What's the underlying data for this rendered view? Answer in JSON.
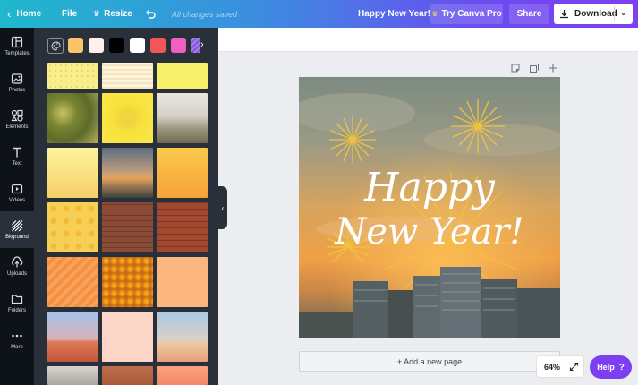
{
  "topbar": {
    "home_label": "Home",
    "file_label": "File",
    "resize_label": "Resize",
    "save_status": "All changes saved",
    "doc_title": "Happy New Year!",
    "try_pro_label": "Try Canva Pro",
    "share_label": "Share",
    "download_label": "Download"
  },
  "rail": {
    "items": [
      {
        "label": "Templates",
        "icon": "templates-icon"
      },
      {
        "label": "Photos",
        "icon": "photos-icon"
      },
      {
        "label": "Elements",
        "icon": "elements-icon"
      },
      {
        "label": "Text",
        "icon": "text-icon"
      },
      {
        "label": "Videos",
        "icon": "videos-icon"
      },
      {
        "label": "Bkground",
        "icon": "background-icon"
      },
      {
        "label": "Uploads",
        "icon": "uploads-icon"
      },
      {
        "label": "Folders",
        "icon": "folders-icon"
      },
      {
        "label": "More",
        "icon": "more-icon"
      }
    ],
    "active": "Bkground"
  },
  "panel": {
    "swatches": [
      "#f9c46a",
      "#fff0ec",
      "#000000",
      "#ffffff",
      "#f25757",
      "#f060c0"
    ]
  },
  "canvas": {
    "headline_line1": "Happy",
    "headline_line2": "New Year!",
    "add_page_label": "+ Add a new page"
  },
  "footer": {
    "zoom_level": "64%",
    "help_label": "Help"
  },
  "colors": {
    "accent": "#7d3ff2",
    "rail_bg": "#0e1318",
    "panel_bg": "#293039"
  }
}
